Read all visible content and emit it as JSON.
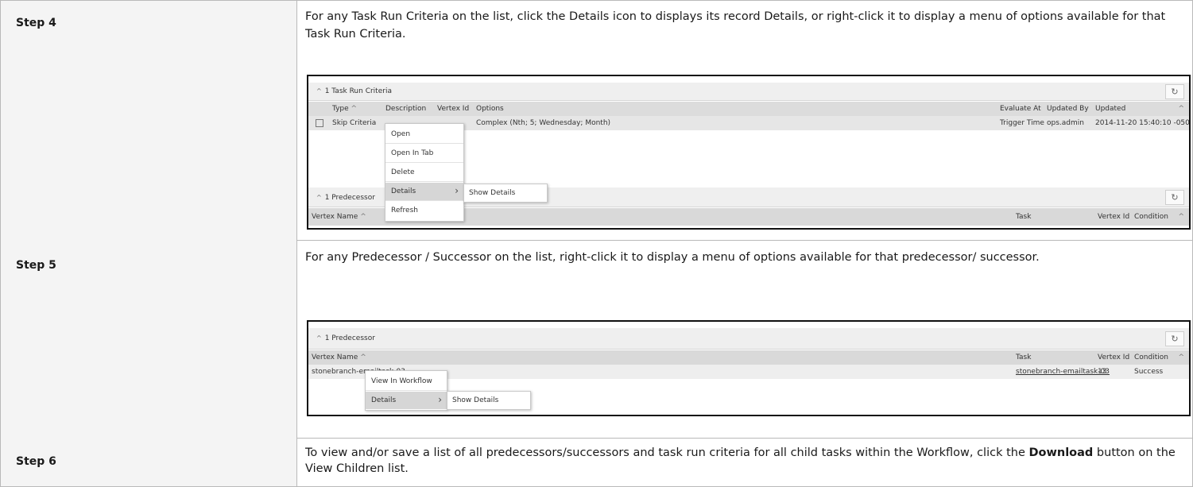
{
  "steps": [
    {
      "label": "Step 4",
      "text": "For any Task Run Criteria on the list, click the Details icon to displays its record Details, or right-click it to display a menu of options available for that Task Run Criteria.",
      "shot": {
        "panel1_title": "1 Task Run Criteria",
        "headers": [
          "Type",
          "Description",
          "Vertex Id",
          "Options",
          "Evaluate At",
          "Updated By",
          "Updated"
        ],
        "row": {
          "type": "Skip Criteria",
          "options": "Complex (Nth; 5; Wednesday; Month)",
          "evaluate_at": "Trigger Time",
          "updated_by": "ops.admin",
          "updated": "2014-11-20 15:40:10 -0500"
        },
        "menu": [
          "Open",
          "Open In Tab",
          "Delete",
          "Details",
          "Refresh"
        ],
        "submenu": "Show Details",
        "panel2_title": "1 Predecessor",
        "panel2_headers": [
          "Vertex Name",
          "Task",
          "Vertex Id",
          "Condition"
        ]
      }
    },
    {
      "label": "Step 5",
      "text": "For any Predecessor / Successor on the list, right-click it to display a menu of options available for that predecessor/ successor.",
      "shot": {
        "panel_title": "1 Predecessor",
        "headers": [
          "Vertex Name",
          "Task",
          "Vertex Id",
          "Condition"
        ],
        "row": {
          "vertex_name": "stonebranch-emailtask-03",
          "task": "stonebranch-emailtask-03",
          "vertex_id": "13",
          "condition": "Success"
        },
        "menu": [
          "View In Workflow",
          "Details"
        ],
        "submenu": "Show Details"
      }
    },
    {
      "label": "Step 6",
      "text_before": "To view and/or save a list of all predecessors/successors and task run criteria for all child tasks within the Workflow, click the ",
      "text_bold": "Download",
      "text_after": " button on the View Children list."
    }
  ],
  "icons": {
    "caret": "caret-up-icon",
    "refresh": "refresh-icon",
    "sort": "sort-up-icon",
    "submenu_arrow": "chevron-right-icon"
  }
}
